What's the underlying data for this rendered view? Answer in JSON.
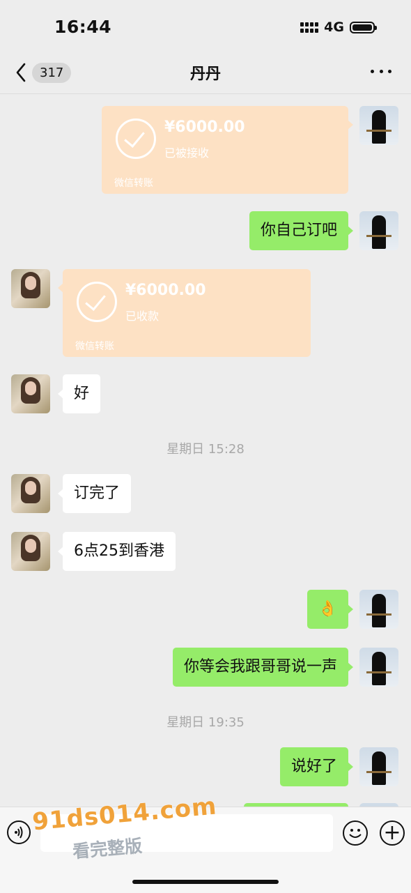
{
  "status_bar": {
    "time": "16:44",
    "network": "4G"
  },
  "nav": {
    "unread_count": "317",
    "title": "丹丹"
  },
  "messages": [
    {
      "type": "transfer",
      "from": "me",
      "amount": "¥6000.00",
      "status": "已被接收",
      "label": "微信转账"
    },
    {
      "type": "text",
      "from": "me",
      "text": "你自己订吧"
    },
    {
      "type": "transfer",
      "from": "them",
      "amount": "¥6000.00",
      "status": "已收款",
      "label": "微信转账"
    },
    {
      "type": "text",
      "from": "them",
      "text": "好"
    },
    {
      "type": "timestamp",
      "text": "星期日 15:28"
    },
    {
      "type": "text",
      "from": "them",
      "text": "订完了"
    },
    {
      "type": "text",
      "from": "them",
      "text": "6点25到香港"
    },
    {
      "type": "text",
      "from": "me",
      "text": "👌"
    },
    {
      "type": "text",
      "from": "me",
      "text": "你等会我跟哥哥说一声"
    },
    {
      "type": "timestamp",
      "text": "星期日 19:35"
    },
    {
      "type": "text",
      "from": "me",
      "text": "说好了"
    }
  ],
  "input_bar": {
    "plus_label": "+"
  },
  "watermark": {
    "url": "91ds014.com",
    "subtitle": "看完整版"
  }
}
